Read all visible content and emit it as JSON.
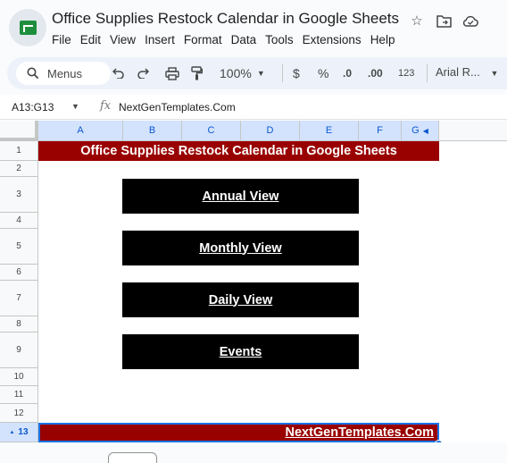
{
  "app": {
    "title": "Office Supplies Restock Calendar in Google Sheets",
    "menu": [
      "File",
      "Edit",
      "View",
      "Insert",
      "Format",
      "Data",
      "Tools",
      "Extensions",
      "Help"
    ]
  },
  "toolbar": {
    "search_label": "Menus",
    "zoom": "100%",
    "currency": "$",
    "percent": "%",
    "decrease_decimal": ".0",
    "increase_decimal": ".00",
    "number_format": "123",
    "font": "Arial R..."
  },
  "formula_bar": {
    "name_box": "A13:G13",
    "fx": "fx",
    "value": "NextGenTemplates.Com"
  },
  "grid": {
    "columns": [
      "A",
      "B",
      "C",
      "D",
      "E",
      "F",
      "G"
    ],
    "rows": [
      "1",
      "2",
      "3",
      "4",
      "5",
      "6",
      "7",
      "8",
      "9",
      "10",
      "11",
      "12",
      "13"
    ],
    "title_cell": "Office Supplies Restock Calendar in Google Sheets",
    "buttons": [
      "Annual View",
      "Monthly View",
      "Daily View",
      "Events"
    ],
    "footer_cell": "NextGenTemplates.Com"
  },
  "colors": {
    "title_fill": "#990000",
    "button_fill": "#000000",
    "selection": "#1a73e8"
  }
}
